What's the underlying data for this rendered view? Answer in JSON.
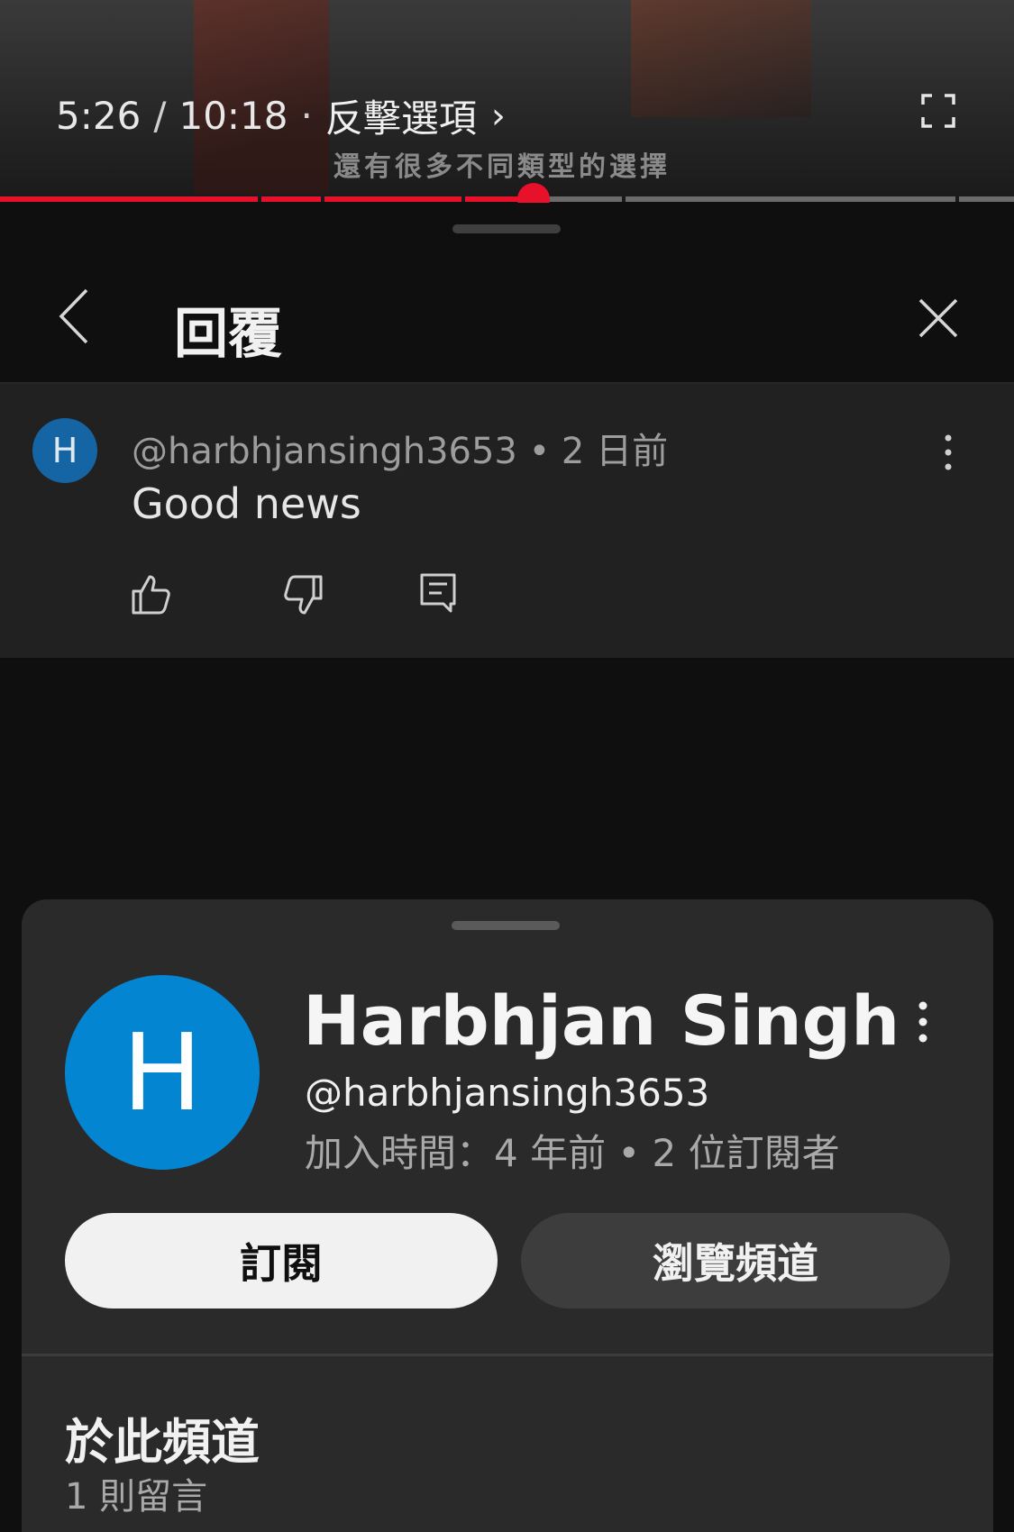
{
  "player": {
    "current_time": "5:26",
    "separator": "/",
    "duration": "10:18",
    "dot": "·",
    "chapter": "反擊選項",
    "chapter_chevron": "›",
    "caption": "還有很多不同類型的選擇",
    "progress": 0.526,
    "accent_color": "#e8102a"
  },
  "reply_panel": {
    "title": "回覆",
    "back_icon": "chevron-left-icon",
    "close_icon": "close-icon"
  },
  "comment": {
    "avatar_letter": "H",
    "author": "@harbhjansingh3653",
    "dot": "•",
    "time": "2 日前",
    "text": "Good news",
    "actions": [
      "like-icon",
      "dislike-icon",
      "reply-icon"
    ]
  },
  "channel_sheet": {
    "avatar_letter": "H",
    "avatar_color": "#0385d1",
    "name": "Harbhjan Singh",
    "handle": "@harbhjansingh3653",
    "stats": "加入時間：4 年前 • 2 位訂閱者",
    "subscribe_label": "訂閱",
    "browse_label": "瀏覽頻道",
    "section_title": "於此頻道",
    "section_sub": "1 則留言"
  }
}
